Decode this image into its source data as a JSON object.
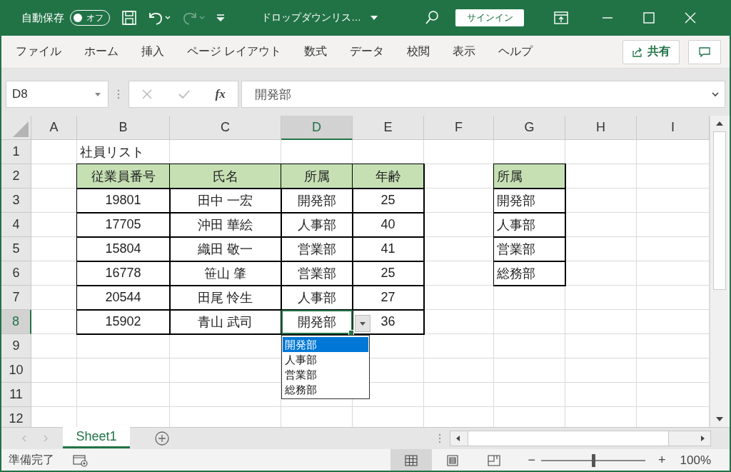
{
  "title_bar": {
    "autosave_label": "自動保存",
    "autosave_toggle": {
      "label": "オフ",
      "on": false
    },
    "redo_disabled": true,
    "document_title": "ドロップダウンリス…",
    "sign_in": "サインイン"
  },
  "ribbon": {
    "tabs": [
      {
        "label": "ファイル",
        "selected": false
      },
      {
        "label": "ホーム",
        "selected": false
      },
      {
        "label": "挿入",
        "selected": false
      },
      {
        "label": "ページ レイアウト",
        "selected": false
      },
      {
        "label": "数式",
        "selected": false
      },
      {
        "label": "データ",
        "selected": false
      },
      {
        "label": "校閲",
        "selected": false
      },
      {
        "label": "表示",
        "selected": false
      },
      {
        "label": "ヘルプ",
        "selected": false
      }
    ],
    "share": "共有"
  },
  "formula_bar": {
    "name_box": "D8",
    "fx": "fx",
    "value": "開発部"
  },
  "sheet": {
    "columns": [
      {
        "label": "A",
        "selected": false
      },
      {
        "label": "B",
        "selected": false
      },
      {
        "label": "C",
        "selected": false
      },
      {
        "label": "D",
        "selected": true
      },
      {
        "label": "E",
        "selected": false
      },
      {
        "label": "F",
        "selected": false
      },
      {
        "label": "G",
        "selected": false
      },
      {
        "label": "H",
        "selected": false
      },
      {
        "label": "I",
        "selected": false
      }
    ],
    "rows": [
      {
        "label": "1",
        "selected": false,
        "cells": [
          {
            "kind": "empty"
          },
          {
            "kind": "title",
            "text": "社員リスト"
          },
          {
            "kind": "empty"
          },
          {
            "kind": "empty"
          },
          {
            "kind": "empty"
          },
          {
            "kind": "empty"
          },
          {
            "kind": "empty"
          },
          {
            "kind": "empty"
          },
          {
            "kind": "empty"
          }
        ]
      },
      {
        "label": "2",
        "selected": false,
        "cells": [
          {
            "kind": "empty"
          },
          {
            "kind": "header",
            "text": "従業員番号"
          },
          {
            "kind": "header",
            "text": "氏名"
          },
          {
            "kind": "header",
            "text": "所属"
          },
          {
            "kind": "header",
            "text": "年齢"
          },
          {
            "kind": "empty"
          },
          {
            "kind": "list-header",
            "text": "所属"
          },
          {
            "kind": "empty"
          },
          {
            "kind": "empty"
          }
        ]
      },
      {
        "label": "3",
        "selected": false,
        "cells": [
          {
            "kind": "empty"
          },
          {
            "kind": "cell",
            "text": "19801"
          },
          {
            "kind": "cell",
            "text": "田中 一宏"
          },
          {
            "kind": "cell",
            "text": "開発部"
          },
          {
            "kind": "cell",
            "text": "25"
          },
          {
            "kind": "empty"
          },
          {
            "kind": "list-cell",
            "text": "開発部"
          },
          {
            "kind": "empty"
          },
          {
            "kind": "empty"
          }
        ]
      },
      {
        "label": "4",
        "selected": false,
        "cells": [
          {
            "kind": "empty"
          },
          {
            "kind": "cell",
            "text": "17705"
          },
          {
            "kind": "cell",
            "text": "沖田 華絵"
          },
          {
            "kind": "cell",
            "text": "人事部"
          },
          {
            "kind": "cell",
            "text": "40"
          },
          {
            "kind": "empty"
          },
          {
            "kind": "list-cell",
            "text": "人事部"
          },
          {
            "kind": "empty"
          },
          {
            "kind": "empty"
          }
        ]
      },
      {
        "label": "5",
        "selected": false,
        "cells": [
          {
            "kind": "empty"
          },
          {
            "kind": "cell",
            "text": "15804"
          },
          {
            "kind": "cell",
            "text": "織田 敬一"
          },
          {
            "kind": "cell",
            "text": "営業部"
          },
          {
            "kind": "cell",
            "text": "41"
          },
          {
            "kind": "empty"
          },
          {
            "kind": "list-cell",
            "text": "営業部"
          },
          {
            "kind": "empty"
          },
          {
            "kind": "empty"
          }
        ]
      },
      {
        "label": "6",
        "selected": false,
        "cells": [
          {
            "kind": "empty"
          },
          {
            "kind": "cell",
            "text": "16778"
          },
          {
            "kind": "cell",
            "text": "笹山 肇"
          },
          {
            "kind": "cell",
            "text": "営業部"
          },
          {
            "kind": "cell",
            "text": "25"
          },
          {
            "kind": "empty"
          },
          {
            "kind": "list-cell",
            "text": "総務部"
          },
          {
            "kind": "empty"
          },
          {
            "kind": "empty"
          }
        ]
      },
      {
        "label": "7",
        "selected": false,
        "cells": [
          {
            "kind": "empty"
          },
          {
            "kind": "cell",
            "text": "20544"
          },
          {
            "kind": "cell",
            "text": "田尾 怜生"
          },
          {
            "kind": "cell",
            "text": "人事部"
          },
          {
            "kind": "cell",
            "text": "27"
          },
          {
            "kind": "empty"
          },
          {
            "kind": "empty"
          },
          {
            "kind": "empty"
          },
          {
            "kind": "empty"
          }
        ]
      },
      {
        "label": "8",
        "selected": true,
        "cells": [
          {
            "kind": "empty"
          },
          {
            "kind": "cell",
            "text": "15902"
          },
          {
            "kind": "cell",
            "text": "青山 武司"
          },
          {
            "kind": "cell",
            "text": "開発部",
            "active": true
          },
          {
            "kind": "cell",
            "text": "36"
          },
          {
            "kind": "empty"
          },
          {
            "kind": "empty"
          },
          {
            "kind": "empty"
          },
          {
            "kind": "empty"
          }
        ]
      },
      {
        "label": "9",
        "selected": false,
        "cells": [
          {
            "kind": "empty"
          },
          {
            "kind": "empty"
          },
          {
            "kind": "empty"
          },
          {
            "kind": "covered"
          },
          {
            "kind": "empty"
          },
          {
            "kind": "empty"
          },
          {
            "kind": "empty"
          },
          {
            "kind": "empty"
          },
          {
            "kind": "empty"
          }
        ]
      },
      {
        "label": "10",
        "selected": false,
        "cells": [
          {
            "kind": "empty"
          },
          {
            "kind": "empty"
          },
          {
            "kind": "empty"
          },
          {
            "kind": "covered"
          },
          {
            "kind": "empty"
          },
          {
            "kind": "empty"
          },
          {
            "kind": "empty"
          },
          {
            "kind": "empty"
          },
          {
            "kind": "empty"
          }
        ]
      },
      {
        "label": "11",
        "selected": false,
        "cells": [
          {
            "kind": "empty"
          },
          {
            "kind": "empty"
          },
          {
            "kind": "empty"
          },
          {
            "kind": "empty"
          },
          {
            "kind": "empty"
          },
          {
            "kind": "empty"
          },
          {
            "kind": "empty"
          },
          {
            "kind": "empty"
          },
          {
            "kind": "empty"
          }
        ]
      },
      {
        "label": "12",
        "selected": false,
        "cells": [
          {
            "kind": "empty"
          },
          {
            "kind": "empty"
          },
          {
            "kind": "empty"
          },
          {
            "kind": "empty"
          },
          {
            "kind": "empty"
          },
          {
            "kind": "empty"
          },
          {
            "kind": "empty"
          },
          {
            "kind": "empty"
          },
          {
            "kind": "empty"
          }
        ]
      }
    ],
    "dropdown": [
      {
        "label": "開発部",
        "selected": true
      },
      {
        "label": "人事部",
        "selected": false
      },
      {
        "label": "営業部",
        "selected": false
      },
      {
        "label": "総務部",
        "selected": false
      }
    ]
  },
  "sheet_tabs": [
    {
      "label": "Sheet1",
      "selected": true
    }
  ],
  "status_bar": {
    "status": "準備完了",
    "views": [
      {
        "kind": "normal",
        "selected": true
      },
      {
        "kind": "page-layout",
        "selected": false
      },
      {
        "kind": "page-break",
        "selected": false
      }
    ],
    "zoom_minus": "−",
    "zoom_plus": "+",
    "zoom": {
      "level": 0.5
    },
    "zoom_label": "100%"
  }
}
